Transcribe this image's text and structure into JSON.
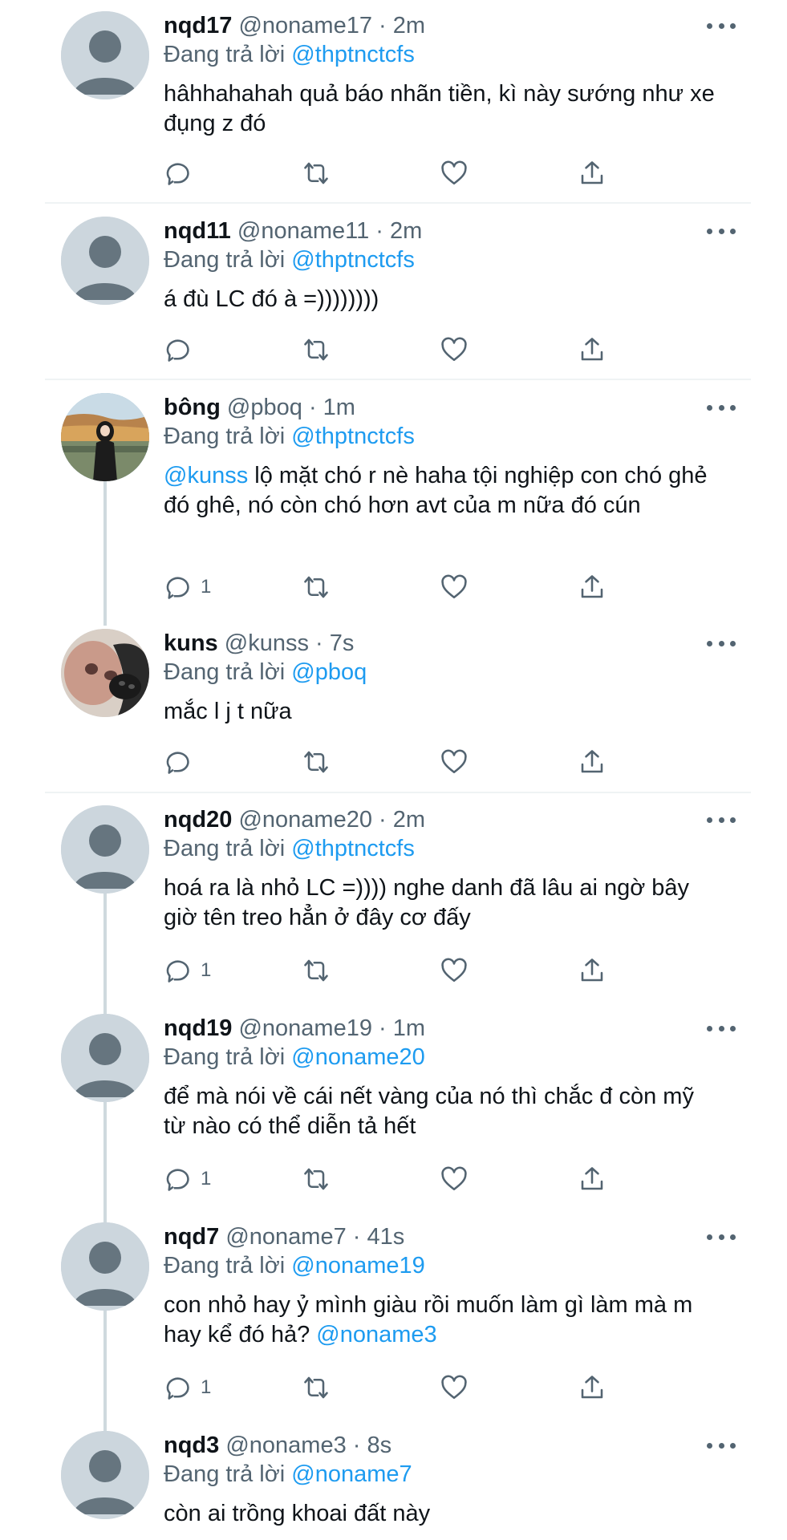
{
  "reply_prefix": "Đang trả lời",
  "tweets": [
    {
      "name": "nqd17",
      "handle": "@noname17",
      "dot": "·",
      "time": "2m",
      "reply_to": "@thptnctcfs",
      "mention": "",
      "text": "hâhhahahah quả báo nhãn tiền, kì này sướng như xe đụng z đó",
      "reply_count": "",
      "avatar": "default"
    },
    {
      "name": "nqd11",
      "handle": "@noname11",
      "dot": "·",
      "time": "2m",
      "reply_to": "@thptnctcfs",
      "mention": "",
      "text": "á đù LC đó à =))))))))",
      "reply_count": "",
      "avatar": "default"
    },
    {
      "name": "bông",
      "handle": "@pboq",
      "dot": "·",
      "time": "1m",
      "reply_to": "@thptnctcfs",
      "mention": "@kunss",
      "text": " lộ mặt chó r nè haha tội nghiệp con chó ghẻ đó ghê, nó còn chó hơn avt của m nữa đó cún",
      "reply_count": "1",
      "avatar": "photo-girl"
    },
    {
      "name": "kuns",
      "handle": "@kunss",
      "dot": "·",
      "time": "7s",
      "reply_to": "@pboq",
      "mention": "",
      "text": "mắc l j t nữa",
      "reply_count": "",
      "avatar": "photo-dog"
    },
    {
      "name": "nqd20",
      "handle": "@noname20",
      "dot": "·",
      "time": "2m",
      "reply_to": "@thptnctcfs",
      "mention": "",
      "text": "hoá ra là nhỏ LC =)))) nghe danh đã lâu ai ngờ bây giờ tên treo hẳn ở đây cơ đấy",
      "reply_count": "1",
      "avatar": "default"
    },
    {
      "name": "nqd19",
      "handle": "@noname19",
      "dot": "·",
      "time": "1m",
      "reply_to": "@noname20",
      "mention": "",
      "text": "để mà nói về cái nết vàng của nó thì chắc đ còn mỹ từ nào có thể diễn tả hết",
      "reply_count": "1",
      "avatar": "default"
    },
    {
      "name": "nqd7",
      "handle": "@noname7",
      "dot": "·",
      "time": "41s",
      "reply_to": "@noname19",
      "mention": "",
      "text": "con nhỏ hay ỷ mình giàu rồi muốn làm gì làm mà m hay kể đó hả? ",
      "trailing_mention": "@noname3",
      "reply_count": "1",
      "avatar": "default"
    },
    {
      "name": "nqd3",
      "handle": "@noname3",
      "dot": "·",
      "time": "8s",
      "reply_to": "@noname7",
      "mention": "",
      "text": "còn ai trồng khoai đất này",
      "reply_count": "",
      "avatar": "default"
    }
  ],
  "icons": {
    "reply": "reply-icon",
    "retweet": "retweet-icon",
    "like": "heart-icon",
    "share": "share-icon",
    "more": "more-icon"
  },
  "colors": {
    "link": "#1d9bf0",
    "secondary": "#536471",
    "avatar_bg": "#ccd6dd",
    "avatar_fg": "#66757f",
    "thread_line": "#cfd9de"
  }
}
